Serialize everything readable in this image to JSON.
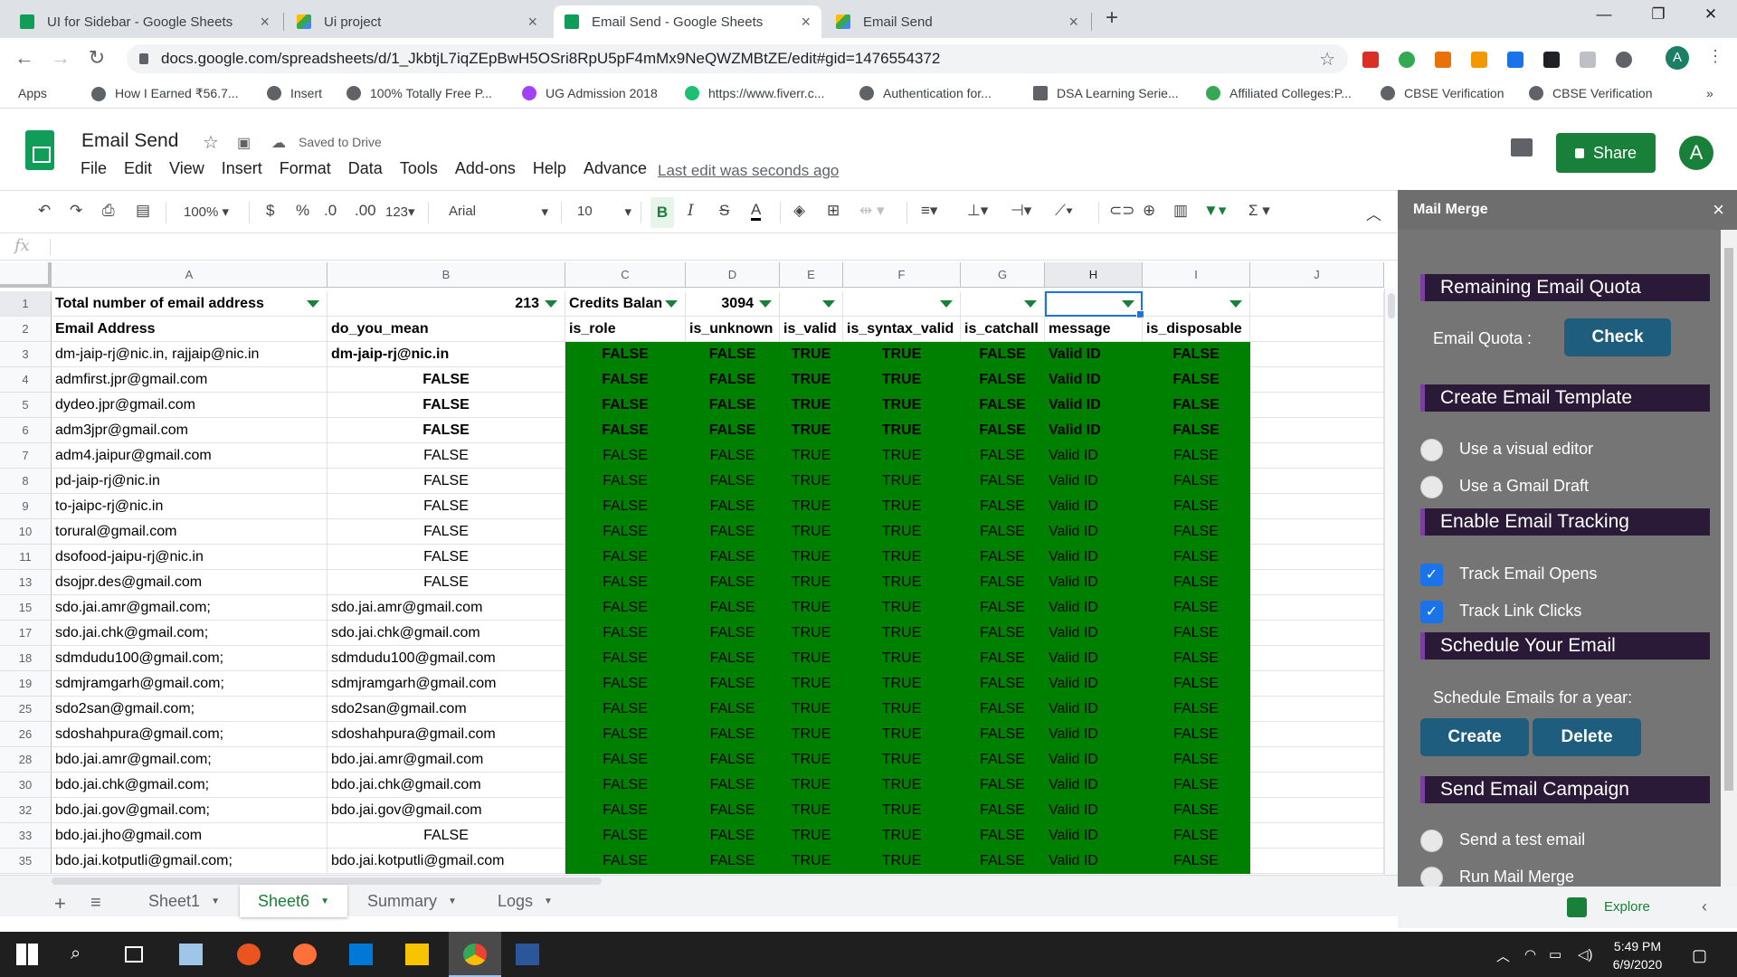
{
  "browser": {
    "tabs": [
      {
        "title": "UI for Sidebar - Google Sheets",
        "icon": "sheets-icon",
        "active": false
      },
      {
        "title": "Ui project",
        "icon": "project-icon",
        "active": false
      },
      {
        "title": "Email Send - Google Sheets",
        "icon": "sheets-icon",
        "active": true
      },
      {
        "title": "Email Send",
        "icon": "project-icon",
        "active": false
      }
    ],
    "new_tab": "+",
    "url": "docs.google.com/spreadsheets/d/1_JkbtjL7iqZEpBwH5OSri8RpU5pF4mMx9NeQWZMBtZE/edit#gid=1476554372",
    "profile_letter": "A",
    "bookmarks": [
      "Apps",
      "How I Earned ₹56.7...",
      "Insert",
      "100% Totally Free P...",
      "UG Admission 2018",
      "https://www.fiverr.c...",
      "Authentication for...",
      "DSA Learning Serie...",
      "Affiliated Colleges:P...",
      "CBSE Verification",
      "CBSE Verification"
    ],
    "more": "»"
  },
  "doc": {
    "title": "Email Send",
    "saved": "Saved to Drive",
    "menus": [
      "File",
      "Edit",
      "View",
      "Insert",
      "Format",
      "Data",
      "Tools",
      "Add-ons",
      "Help",
      "Advance"
    ],
    "last_edit": "Last edit was seconds ago",
    "share": "Share",
    "avatar": "A"
  },
  "toolbar": {
    "zoom": "100%",
    "currency": "$",
    "percent": "%",
    "dec_less": ".0",
    "dec_more": ".00",
    "format_more": "123",
    "font": "Arial",
    "font_size": "10",
    "bold": "B",
    "italic": "I",
    "strike": "S",
    "text_color": "A",
    "sum": "Σ"
  },
  "formula_bar": {
    "fx": "fx",
    "value": ""
  },
  "columns": [
    "A",
    "B",
    "C",
    "D",
    "E",
    "F",
    "G",
    "H",
    "I",
    "J"
  ],
  "selected_column": "H",
  "row1": {
    "num": "1",
    "cells": [
      "Total number of email address",
      "213",
      "Credits Balan",
      "3094",
      "",
      "",
      "",
      "",
      ""
    ]
  },
  "row2": {
    "num": "2",
    "cells": [
      "Email Address",
      "do_you_mean",
      "is_role",
      "is_unknown",
      "is_valid",
      "is_syntax_valid",
      "is_catchall",
      "message",
      "is_disposable"
    ]
  },
  "data_rows": [
    {
      "num": "3",
      "a": "dm-jaip-rj@nic.in, rajjaip@nic.in",
      "b": "dm-jaip-rj@nic.in",
      "bold": true
    },
    {
      "num": "4",
      "a": "admfirst.jpr@gmail.com",
      "b": "FALSE",
      "bold": true
    },
    {
      "num": "5",
      "a": "dydeo.jpr@gmail.com",
      "b": "FALSE",
      "bold": true
    },
    {
      "num": "6",
      "a": "adm3jpr@gmail.com",
      "b": "FALSE",
      "bold": true
    },
    {
      "num": "7",
      "a": "adm4.jaipur@gmail.com",
      "b": "FALSE",
      "bold": false
    },
    {
      "num": "8",
      "a": "pd-jaip-rj@nic.in",
      "b": "FALSE",
      "bold": false
    },
    {
      "num": "9",
      "a": "to-jaipc-rj@nic.in",
      "b": "FALSE",
      "bold": false
    },
    {
      "num": "10",
      "a": "torural@gmail.com",
      "b": "FALSE",
      "bold": false
    },
    {
      "num": "11",
      "a": "dsofood-jaipu-rj@nic.in",
      "b": "FALSE",
      "bold": false
    },
    {
      "num": "13",
      "a": "dsojpr.des@gmail.com",
      "b": "FALSE",
      "bold": false
    },
    {
      "num": "15",
      "a": "sdo.jai.amr@gmail.com;",
      "b": "sdo.jai.amr@gmail.com",
      "bold": false
    },
    {
      "num": "17",
      "a": "sdo.jai.chk@gmail.com;",
      "b": "sdo.jai.chk@gmail.com",
      "bold": false
    },
    {
      "num": "18",
      "a": "sdmdudu100@gmail.com;",
      "b": "sdmdudu100@gmail.com",
      "bold": false
    },
    {
      "num": "19",
      "a": "sdmjramgarh@gmail.com;",
      "b": "sdmjramgarh@gmail.com",
      "bold": false
    },
    {
      "num": "25",
      "a": "sdo2san@gmail.com;",
      "b": "sdo2san@gmail.com",
      "bold": false
    },
    {
      "num": "26",
      "a": "sdoshahpura@gmail.com;",
      "b": "sdoshahpura@gmail.com",
      "bold": false
    },
    {
      "num": "28",
      "a": "bdo.jai.amr@gmail.com;",
      "b": "bdo.jai.amr@gmail.com",
      "bold": false
    },
    {
      "num": "30",
      "a": "bdo.jai.chk@gmail.com;",
      "b": "bdo.jai.chk@gmail.com",
      "bold": false
    },
    {
      "num": "32",
      "a": "bdo.jai.gov@gmail.com;",
      "b": "bdo.jai.gov@gmail.com",
      "bold": false
    },
    {
      "num": "33",
      "a": "bdo.jai.jho@gmail.com",
      "b": "FALSE",
      "bold": false
    },
    {
      "num": "35",
      "a": "bdo.jai.kotputli@gmail.com;",
      "b": "bdo.jai.kotputli@gmail.com",
      "bold": false
    }
  ],
  "green_values": {
    "c": "FALSE",
    "d": "FALSE",
    "e": "TRUE",
    "f": "TRUE",
    "g": "FALSE",
    "h": "Valid ID",
    "i": "FALSE"
  },
  "colors": {
    "green_fill": "#008000",
    "share": "#188038",
    "sidebar_bg": "#757575",
    "section_title": "#2b1a37",
    "sidebar_button": "#1e5d7e"
  },
  "sheets": [
    {
      "name": "Sheet1",
      "active": false
    },
    {
      "name": "Sheet6",
      "active": true
    },
    {
      "name": "Summary",
      "active": false
    },
    {
      "name": "Logs",
      "active": false
    }
  ],
  "sidebar": {
    "title": "Mail Merge",
    "close": "×",
    "sections": {
      "quota": "Remaining Email Quota",
      "template": "Create Email Template",
      "tracking": "Enable Email Tracking",
      "schedule": "Schedule Your Email",
      "campaign": "Send Email Campaign"
    },
    "quota_label": "Email Quota :",
    "check_button": "Check",
    "visual_editor": "Use a visual editor",
    "gmail_draft": "Use a Gmail Draft",
    "track_opens": "Track Email Opens",
    "track_clicks": "Track Link Clicks",
    "schedule_label": "Schedule Emails for a year:",
    "create_button": "Create",
    "delete_button": "Delete",
    "test_email": "Send a test email",
    "run_merge": "Run Mail Merge",
    "explore": "Explore"
  },
  "taskbar": {
    "time": "5:49 PM",
    "date": "6/9/2020"
  }
}
